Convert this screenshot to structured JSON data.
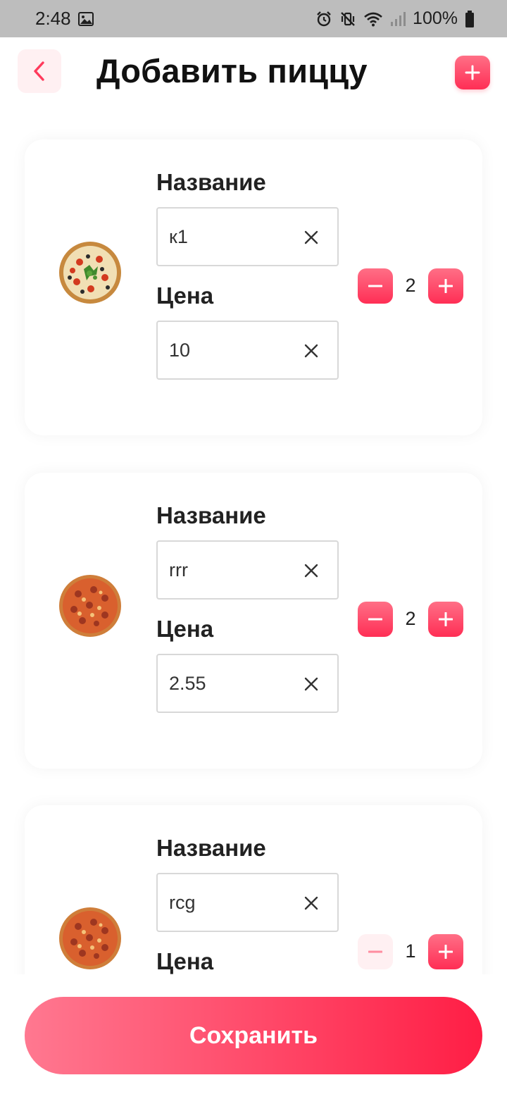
{
  "status_bar": {
    "time": "2:48",
    "battery": "100%"
  },
  "header": {
    "title": "Добавить пиццу",
    "back_icon": "chevron-left-icon",
    "add_icon": "plus-icon"
  },
  "pizzas": [
    {
      "name_label": "Название",
      "name_value": "к1",
      "price_label": "Цена",
      "price_value": "10",
      "quantity": "2",
      "minus_enabled": true
    },
    {
      "name_label": "Название",
      "name_value": "rrr",
      "price_label": "Цена",
      "price_value": "2.55",
      "quantity": "2",
      "minus_enabled": true
    },
    {
      "name_label": "Название",
      "name_value": "rcg",
      "price_label": "Цена",
      "price_value": "",
      "quantity": "1",
      "minus_enabled": false
    }
  ],
  "save_button": {
    "label": "Сохранить"
  },
  "colors": {
    "accent": "#ff2e55",
    "accent_light": "#fff0f2",
    "status_bar": "#bdbdbd"
  }
}
